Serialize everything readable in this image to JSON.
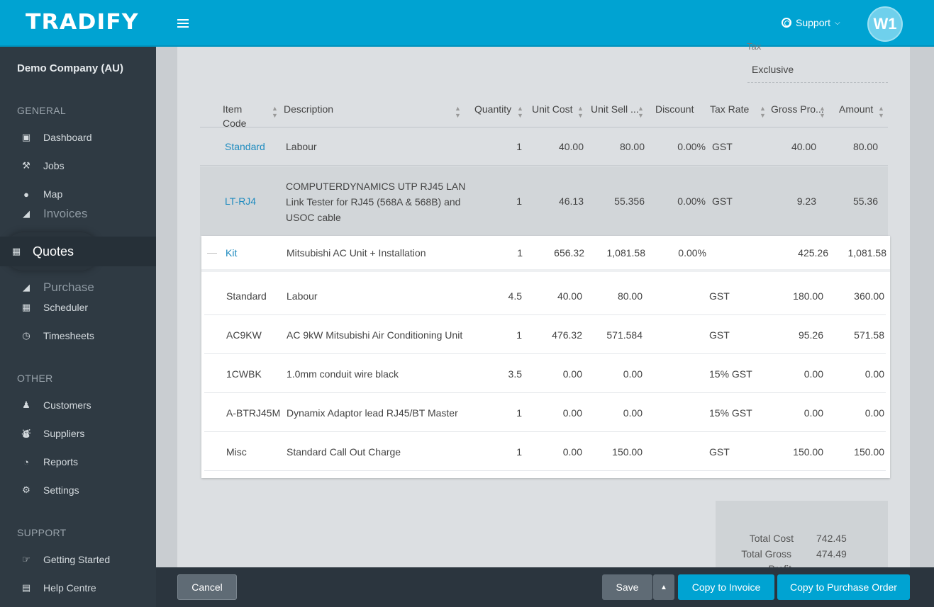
{
  "app": {
    "logo": "TRADIFY",
    "support_label": "Support",
    "avatar_initials": "W1"
  },
  "sidebar": {
    "company": "Demo Company (AU)",
    "sections": {
      "general": "GENERAL",
      "other": "OTHER",
      "support": "SUPPORT"
    },
    "items": [
      {
        "label": "Dashboard",
        "icon": "dashboard-icon"
      },
      {
        "label": "Jobs",
        "icon": "hammer-icon"
      },
      {
        "label": "Map",
        "icon": "map-pin-icon"
      },
      {
        "label": "Invoices",
        "icon": "invoice-icon"
      },
      {
        "label": "Quotes",
        "icon": "calculator-icon"
      },
      {
        "label": "Purchase",
        "icon": "purchase-icon"
      },
      {
        "label": "Scheduler",
        "icon": "calendar-icon"
      },
      {
        "label": "Timesheets",
        "icon": "clock-icon"
      },
      {
        "label": "Customers",
        "icon": "users-icon"
      },
      {
        "label": "Suppliers",
        "icon": "truck-icon"
      },
      {
        "label": "Reports",
        "icon": "pie-chart-icon"
      },
      {
        "label": "Settings",
        "icon": "gear-icon"
      },
      {
        "label": "Getting Started",
        "icon": "thumbs-up-icon"
      },
      {
        "label": "Help Centre",
        "icon": "book-icon"
      }
    ]
  },
  "quote": {
    "tax_label": "Tax",
    "tax_value": "Exclusive",
    "columns": {
      "item_code": "Item Code",
      "description": "Description",
      "quantity": "Quantity",
      "unit_cost": "Unit Cost",
      "unit_sell": "Unit Sell ...",
      "discount": "Discount",
      "tax_rate": "Tax Rate",
      "gross_profit": "Gross Pro...",
      "amount": "Amount"
    },
    "rows": [
      {
        "code": "Standard",
        "description": "Labour",
        "qty": "1",
        "unit_cost": "40.00",
        "unit_sell": "80.00",
        "discount": "0.00%",
        "tax": "GST",
        "gross": "40.00",
        "amount": "80.00"
      },
      {
        "code": "LT-RJ4",
        "description_lines": [
          "COMPUTERDYNAMICS UTP RJ45 LAN",
          "Link Tester for RJ45 (568A & 568B) and",
          "USOC cable"
        ],
        "qty": "1",
        "unit_cost": "46.13",
        "unit_sell": "55.356",
        "discount": "0.00%",
        "tax": "GST",
        "gross": "9.23",
        "amount": "55.36"
      }
    ],
    "kit": {
      "code": "Kit",
      "description": "Mitsubishi AC Unit + Installation",
      "qty": "1",
      "unit_cost": "656.32",
      "unit_sell": "1,081.58",
      "discount": "0.00%",
      "gross": "425.26",
      "amount": "1,081.58"
    },
    "kit_items": [
      {
        "code": "Standard",
        "description": "Labour",
        "qty": "4.5",
        "unit_cost": "40.00",
        "unit_sell": "80.00",
        "tax": "GST",
        "gross": "180.00",
        "amount": "360.00"
      },
      {
        "code": "AC9KW",
        "description": "AC 9kW Mitsubishi Air Conditioning Unit",
        "qty": "1",
        "unit_cost": "476.32",
        "unit_sell": "571.584",
        "tax": "GST",
        "gross": "95.26",
        "amount": "571.58"
      },
      {
        "code": "1CWBK",
        "description": "1.0mm conduit wire black",
        "qty": "3.5",
        "unit_cost": "0.00",
        "unit_sell": "0.00",
        "tax": "15% GST",
        "gross": "0.00",
        "amount": "0.00"
      },
      {
        "code": "A-BTRJ45M",
        "description": "Dynamix Adaptor lead RJ45/BT Master",
        "qty": "1",
        "unit_cost": "0.00",
        "unit_sell": "0.00",
        "tax": "15% GST",
        "gross": "0.00",
        "amount": "0.00"
      },
      {
        "code": "Misc",
        "description": "Standard Call Out Charge",
        "qty": "1",
        "unit_cost": "0.00",
        "unit_sell": "150.00",
        "tax": "GST",
        "gross": "150.00",
        "amount": "150.00"
      }
    ],
    "totals": {
      "total_cost_label": "Total Cost",
      "total_cost": "742.45",
      "total_gross_label": "Total Gross",
      "total_gross": "474.49",
      "profit_label": "Profit"
    }
  },
  "footer": {
    "cancel": "Cancel",
    "save": "Save",
    "copy_invoice": "Copy to Invoice",
    "copy_po": "Copy to Purchase Order"
  }
}
